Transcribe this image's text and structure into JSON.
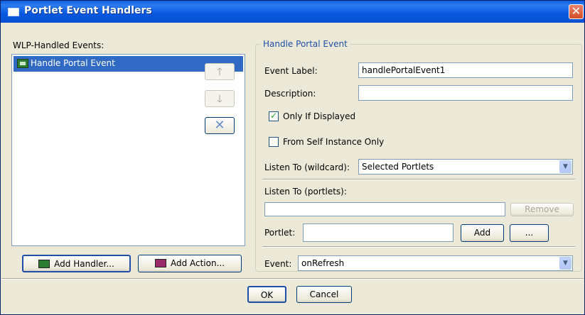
{
  "window": {
    "title": "Portlet Event Handlers",
    "close_glyph": "✕"
  },
  "left": {
    "events_label": "WLP-Handled Events:",
    "events": [
      {
        "label": "Handle Portal Event",
        "icon": "event-handler-icon",
        "selected": true
      }
    ],
    "move_up_glyph": "🡑",
    "move_down_glyph": "🡓",
    "remove_glyph": "✕",
    "add_handler_label": "Add Handler...",
    "add_action_label": "Add Action..."
  },
  "details": {
    "group_title": "Handle Portal Event",
    "event_label_label": "Event Label:",
    "event_label_value": "handlePortalEvent1",
    "description_label": "Description:",
    "description_value": "",
    "only_if_displayed": {
      "label": "Only If Displayed",
      "checked": true
    },
    "from_self_instance": {
      "label": "From Self Instance Only",
      "checked": false
    },
    "listen_wildcard_label": "Listen To (wildcard):",
    "listen_wildcard_value": "Selected Portlets",
    "listen_portlets_label": "Listen To (portlets):",
    "listen_portlets_value": "",
    "remove_label": "Remove",
    "portlet_label": "Portlet:",
    "portlet_value": "",
    "add_label": "Add",
    "browse_label": "...",
    "event_label": "Event:",
    "event_value": "onRefresh"
  },
  "footer": {
    "ok_label": "OK",
    "cancel_label": "Cancel"
  },
  "colors": {
    "titlebar": "#0a5ce2",
    "selection": "#316ac5",
    "group_title": "#1f4fa8",
    "close": "#d44d27"
  }
}
